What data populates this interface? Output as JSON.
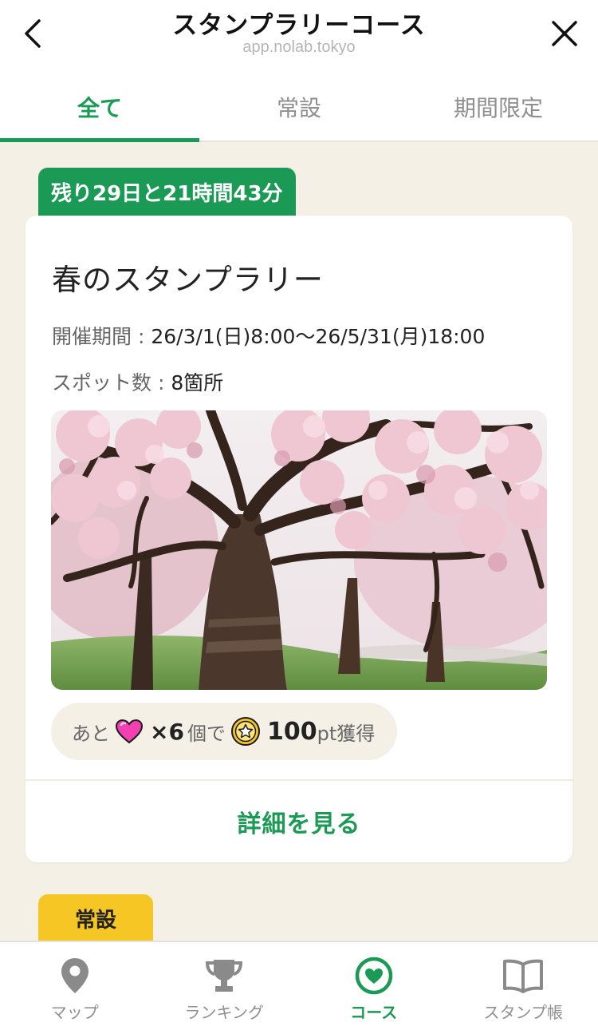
{
  "header": {
    "title": "スタンプラリーコース",
    "domain": "app.nolab.tokyo"
  },
  "tabs": [
    {
      "label": "全て",
      "active": true
    },
    {
      "label": "常設",
      "active": false
    },
    {
      "label": "期間限定",
      "active": false
    }
  ],
  "course": {
    "remaining": "残り29日と21時間43分",
    "title": "春のスタンプラリー",
    "period_label": "開催期間 : ",
    "period_value": "26/3/1(日)8:00〜26/5/31(月)18:00",
    "spots_label": "スポット数 : ",
    "spots_value": "8箇所",
    "image": "cherry-blossom-trees-photo",
    "reward": {
      "prefix": "あと",
      "count": "×6",
      "middle": "個で",
      "points": "100",
      "suffix": "pt獲得"
    },
    "details_label": "詳細を見る"
  },
  "section_badge": "常設",
  "nav": [
    {
      "label": "マップ",
      "icon": "map-pin-icon",
      "active": false
    },
    {
      "label": "ランキング",
      "icon": "trophy-icon",
      "active": false
    },
    {
      "label": "コース",
      "icon": "heart-circle-icon",
      "active": true
    },
    {
      "label": "スタンプ帳",
      "icon": "book-icon",
      "active": false
    }
  ],
  "colors": {
    "accent_green": "#1a9a55",
    "badge_yellow": "#f6c624",
    "background": "#f4f0e6",
    "heart_pink": "#f23fb1"
  }
}
